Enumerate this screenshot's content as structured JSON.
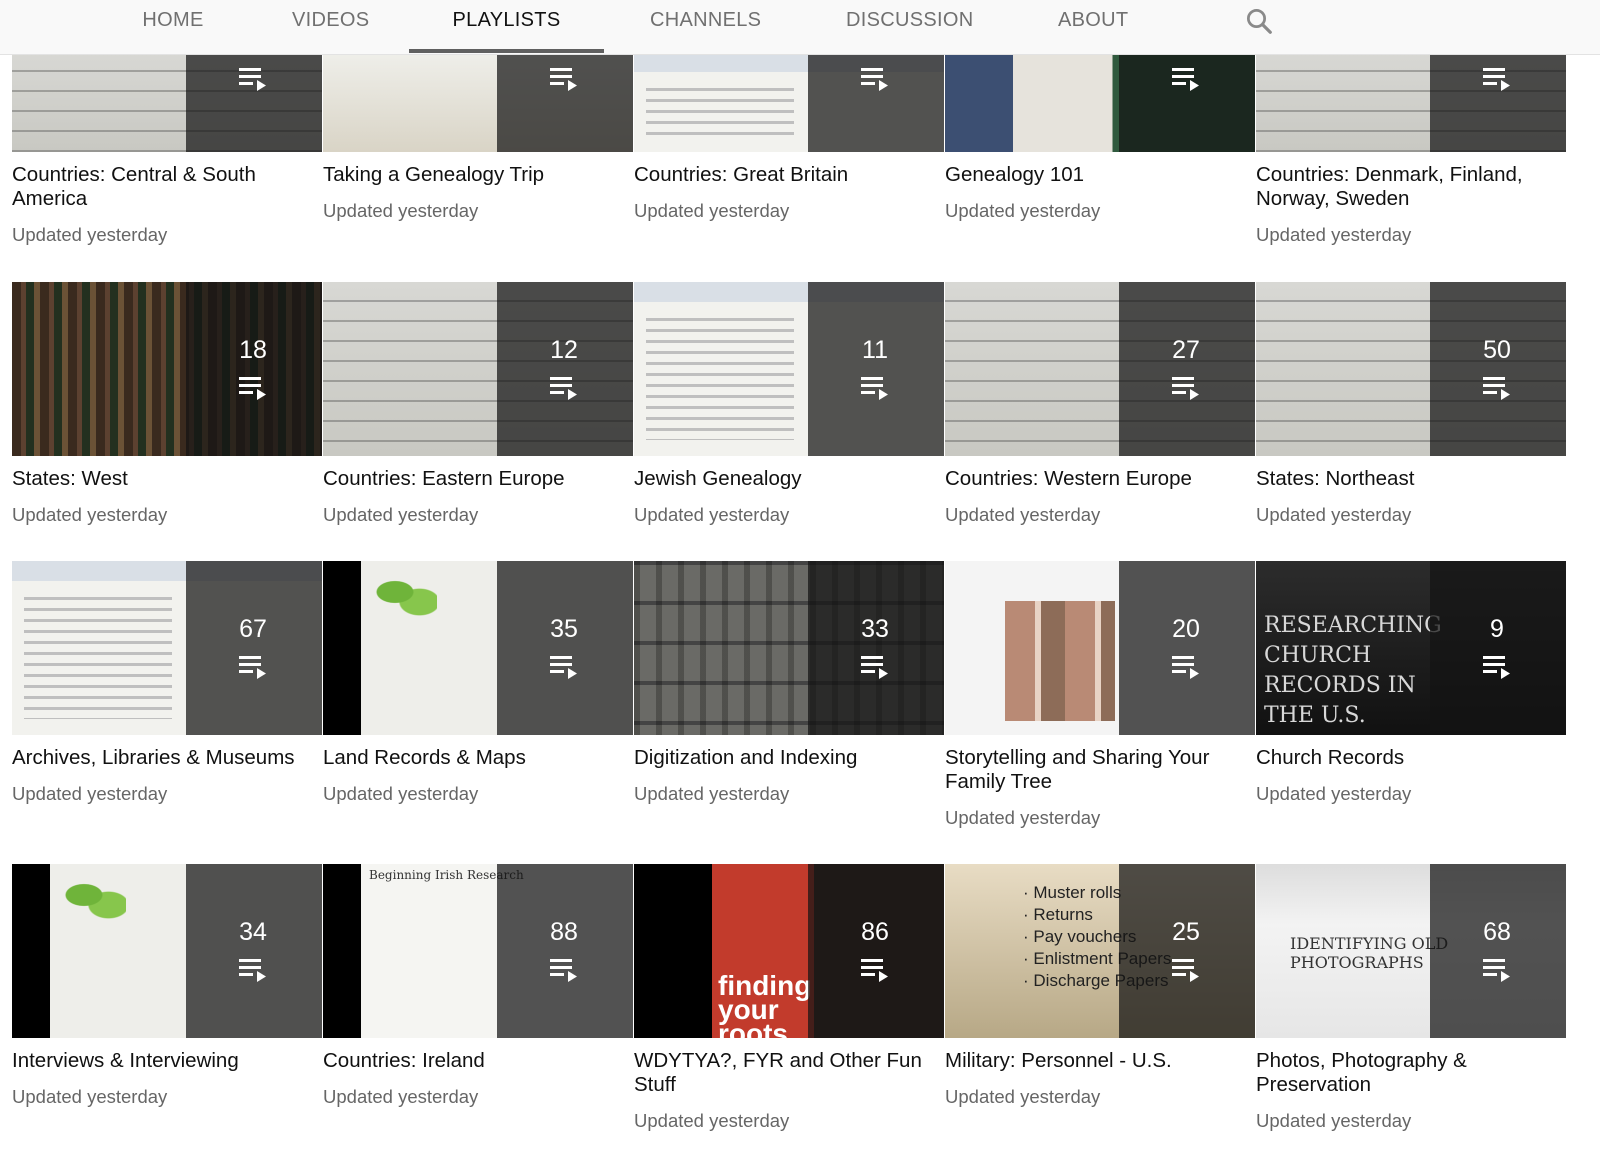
{
  "tabs": [
    {
      "label": "HOME",
      "active": false
    },
    {
      "label": "VIDEOS",
      "active": false
    },
    {
      "label": "PLAYLISTS",
      "active": true
    },
    {
      "label": "CHANNELS",
      "active": false
    },
    {
      "label": "DISCUSSION",
      "active": false
    },
    {
      "label": "ABOUT",
      "active": false
    }
  ],
  "search_icon": "search-icon",
  "playlist_icon": "playlist-icon",
  "updated_label": "Updated yesterday",
  "playlists": [
    {
      "title": "Countries: Central & South America",
      "count": "",
      "thumb": "doc"
    },
    {
      "title": "Taking a Genealogy Trip",
      "count": "",
      "thumb": "slide"
    },
    {
      "title": "Countries: Great Britain",
      "count": "",
      "thumb": "web"
    },
    {
      "title": "Genealogy 101",
      "count": "",
      "thumb": "man"
    },
    {
      "title": "Countries: Denmark, Finland, Norway, Sweden",
      "count": "",
      "thumb": "doc"
    },
    {
      "title": "States: West",
      "count": "18",
      "thumb": "books"
    },
    {
      "title": "Countries: Eastern Europe",
      "count": "12",
      "thumb": "doc"
    },
    {
      "title": "Jewish Genealogy",
      "count": "11",
      "thumb": "web"
    },
    {
      "title": "Countries: Western Europe",
      "count": "27",
      "thumb": "doc"
    },
    {
      "title": "States: Northeast",
      "count": "50",
      "thumb": "doc"
    },
    {
      "title": "Archives, Libraries & Museums",
      "count": "67",
      "thumb": "web"
    },
    {
      "title": "Land Records & Maps",
      "count": "35",
      "thumb": "leafslide"
    },
    {
      "title": "Digitization and Indexing",
      "count": "33",
      "thumb": "shelves"
    },
    {
      "title": "Storytelling and Sharing Your Family Tree",
      "count": "20",
      "thumb": "collage"
    },
    {
      "title": "Church Records",
      "count": "9",
      "thumb": "church"
    },
    {
      "title": "Interviews & Interviewing",
      "count": "34",
      "thumb": "leafslide"
    },
    {
      "title": "Countries: Ireland",
      "count": "88",
      "thumb": "irish"
    },
    {
      "title": "WDYTYA?, FYR and Other Fun Stuff",
      "count": "86",
      "thumb": "reddoc"
    },
    {
      "title": "Military: Personnel - U.S.",
      "count": "25",
      "thumb": "military"
    },
    {
      "title": "Photos, Photography & Preservation",
      "count": "68",
      "thumb": "photos"
    }
  ]
}
